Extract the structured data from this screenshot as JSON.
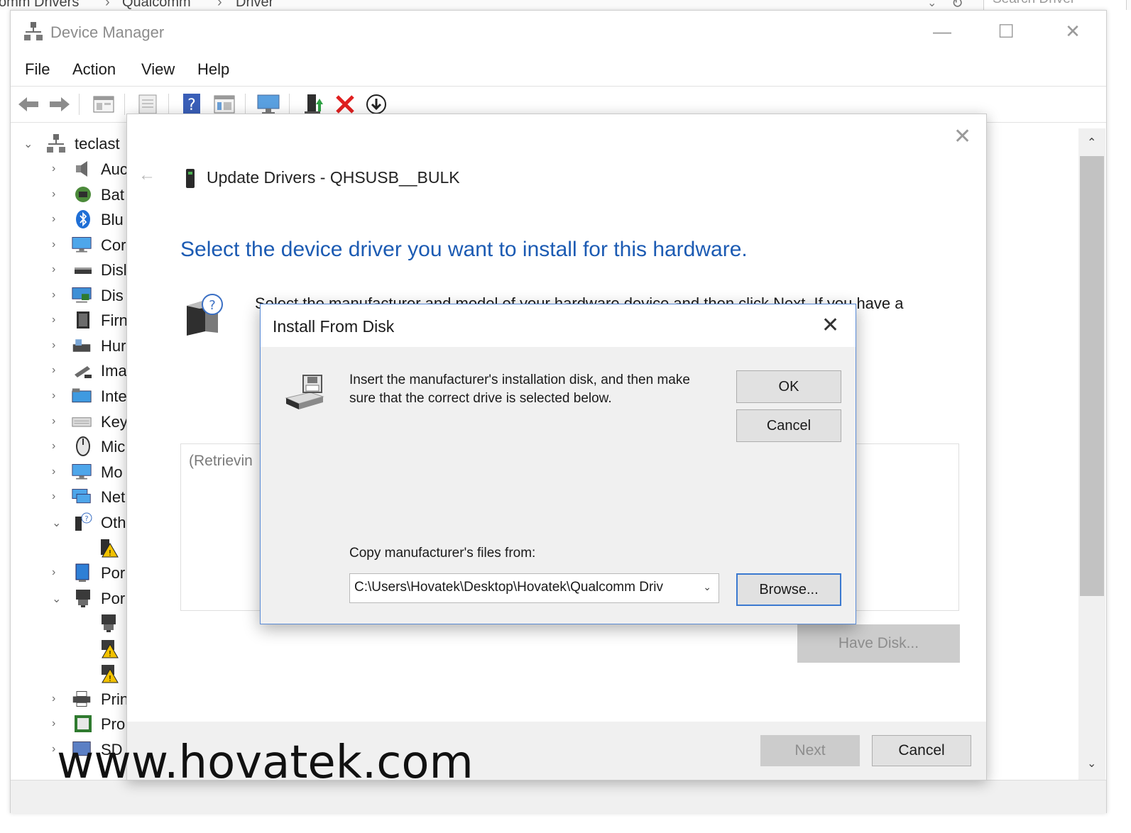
{
  "explorer": {
    "breadcrumb": [
      "omm Drivers",
      "Qualcomm",
      "Driver"
    ],
    "search_placeholder": "Search Driver"
  },
  "device_manager": {
    "title": "Device Manager",
    "menu": [
      "File",
      "Action",
      "View",
      "Help"
    ],
    "tree": {
      "root": "teclast",
      "items": [
        {
          "label": "Auc",
          "icon": "speaker-icon",
          "expanded": false
        },
        {
          "label": "Bat",
          "icon": "battery-icon",
          "expanded": false
        },
        {
          "label": "Blu",
          "icon": "bluetooth-icon",
          "expanded": false
        },
        {
          "label": "Cor",
          "icon": "monitor-icon",
          "expanded": false
        },
        {
          "label": "Disl",
          "icon": "disk-icon",
          "expanded": false
        },
        {
          "label": "Dis",
          "icon": "display-icon",
          "expanded": false
        },
        {
          "label": "Firn",
          "icon": "firmware-icon",
          "expanded": false
        },
        {
          "label": "Hur",
          "icon": "hid-icon",
          "expanded": false
        },
        {
          "label": "Ima",
          "icon": "camera-icon",
          "expanded": false
        },
        {
          "label": "Inte",
          "icon": "intel-icon",
          "expanded": false
        },
        {
          "label": "Key",
          "icon": "keyboard-icon",
          "expanded": false
        },
        {
          "label": "Mic",
          "icon": "mouse-icon",
          "expanded": false
        },
        {
          "label": "Mo",
          "icon": "monitor-icon",
          "expanded": false
        },
        {
          "label": "Net",
          "icon": "network-icon",
          "expanded": false
        },
        {
          "label": "Oth",
          "icon": "unknown-device-icon",
          "expanded": true
        },
        {
          "label": "",
          "icon": "warning-device-icon",
          "child": true
        },
        {
          "label": "Por",
          "icon": "portable-icon",
          "expanded": false
        },
        {
          "label": "Por",
          "icon": "port-icon",
          "expanded": true
        },
        {
          "label": "",
          "icon": "port-child-icon",
          "child": true
        },
        {
          "label": "",
          "icon": "warning-device-icon",
          "child": true
        },
        {
          "label": "",
          "icon": "warning-device-icon",
          "child": true
        },
        {
          "label": "Prin",
          "icon": "printer-icon",
          "expanded": false
        },
        {
          "label": "Pro",
          "icon": "processor-icon",
          "expanded": false
        },
        {
          "label": "SD",
          "icon": "sd-icon",
          "expanded": false
        }
      ]
    }
  },
  "wizard": {
    "title": "Update Drivers - QHSUSB__BULK",
    "heading": "Select the device driver you want to install for this hardware.",
    "description": "Select the manufacturer and model of your hardware device and then click Next. If you have a",
    "list_placeholder": "(Retrievin",
    "have_disk_label": "Have Disk...",
    "next_label": "Next",
    "cancel_label": "Cancel"
  },
  "install_from_disk": {
    "title": "Install From Disk",
    "message": "Insert the manufacturer's installation disk, and then make sure that the correct drive is selected below.",
    "ok_label": "OK",
    "cancel_label": "Cancel",
    "copy_label": "Copy manufacturer's files from:",
    "path_value": "C:\\Users\\Hovatek\\Desktop\\Hovatek\\Qualcomm Driv",
    "browse_label": "Browse..."
  },
  "watermark": "www.hovatek.com",
  "colors": {
    "heading_blue": "#1c5bb3",
    "focus_border": "#3b79d0",
    "disabled_button": "#cccccc"
  }
}
